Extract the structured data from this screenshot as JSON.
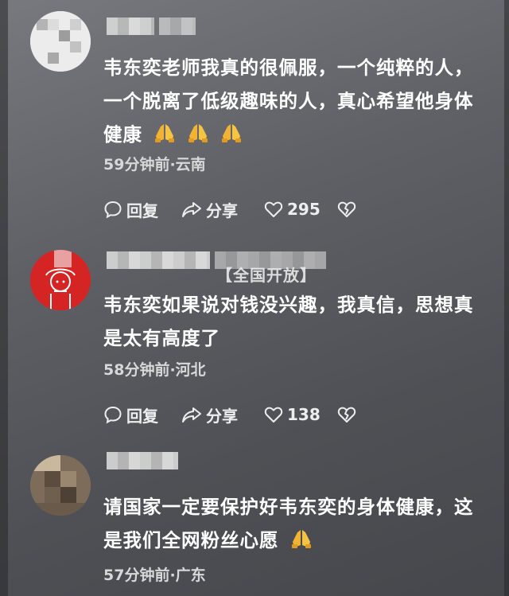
{
  "comments": [
    {
      "text_lines": [
        "韦东奕老师我真的很佩服，一个纯粹的人，",
        "一个脱离了低级趣味的人，真心希望他身体",
        "健康"
      ],
      "emoji_count": 3,
      "emoji_name": "praying-hands-emoji",
      "meta": "59分钟前·云南",
      "reply_label": "回复",
      "share_label": "分享",
      "like_count": "295"
    },
    {
      "badge": "【全国开放】",
      "text_lines": [
        "韦东奕如果说对钱没兴趣，我真信，思想真",
        "是太有高度了"
      ],
      "meta": "58分钟前·河北",
      "reply_label": "回复",
      "share_label": "分享",
      "like_count": "138"
    },
    {
      "text_lines": [
        "请国家一定要保护好韦东奕的身体健康，这",
        "是我们全网粉丝心愿"
      ],
      "emoji_count": 1,
      "emoji_name": "praying-hands-emoji",
      "meta": "57分钟前·广东"
    }
  ],
  "colors": {
    "text": "#ffffff",
    "meta": "#d8d8da",
    "action": "#eeeeee"
  }
}
